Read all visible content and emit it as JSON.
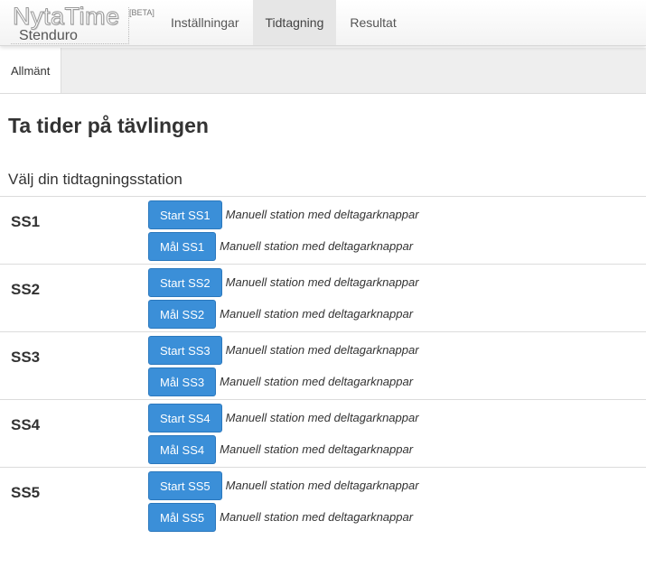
{
  "brand": {
    "logo": "NytaTime",
    "beta": "[BETA]",
    "subtitle": "Stenduro"
  },
  "nav": {
    "tabs": [
      {
        "label": "Inställningar",
        "active": false
      },
      {
        "label": "Tidtagning",
        "active": true
      },
      {
        "label": "Resultat",
        "active": false
      }
    ]
  },
  "subnav": {
    "tabs": [
      {
        "label": "Allmänt",
        "active": true
      }
    ]
  },
  "page": {
    "title": "Ta tider på tävlingen",
    "section_title": "Välj din tidtagningsstation"
  },
  "stations": [
    {
      "name": "SS1",
      "start_label": "Start SS1",
      "finish_label": "Mål SS1",
      "start_desc": "Manuell station med deltagarknappar",
      "finish_desc": "Manuell station med deltagarknappar"
    },
    {
      "name": "SS2",
      "start_label": "Start SS2",
      "finish_label": "Mål SS2",
      "start_desc": "Manuell station med deltagarknappar",
      "finish_desc": "Manuell station med deltagarknappar"
    },
    {
      "name": "SS3",
      "start_label": "Start SS3",
      "finish_label": "Mål SS3",
      "start_desc": "Manuell station med deltagarknappar",
      "finish_desc": "Manuell station med deltagarknappar"
    },
    {
      "name": "SS4",
      "start_label": "Start SS4",
      "finish_label": "Mål SS4",
      "start_desc": "Manuell station med deltagarknappar",
      "finish_desc": "Manuell station med deltagarknappar"
    },
    {
      "name": "SS5",
      "start_label": "Start SS5",
      "finish_label": "Mål SS5",
      "start_desc": "Manuell station med deltagarknappar",
      "finish_desc": "Manuell station med deltagarknappar"
    }
  ],
  "colors": {
    "button_bg": "#3b8fd8",
    "button_border": "#2b78bd",
    "active_tab_bg": "#e6e6e6",
    "subbar_bg": "#eeeeee"
  }
}
